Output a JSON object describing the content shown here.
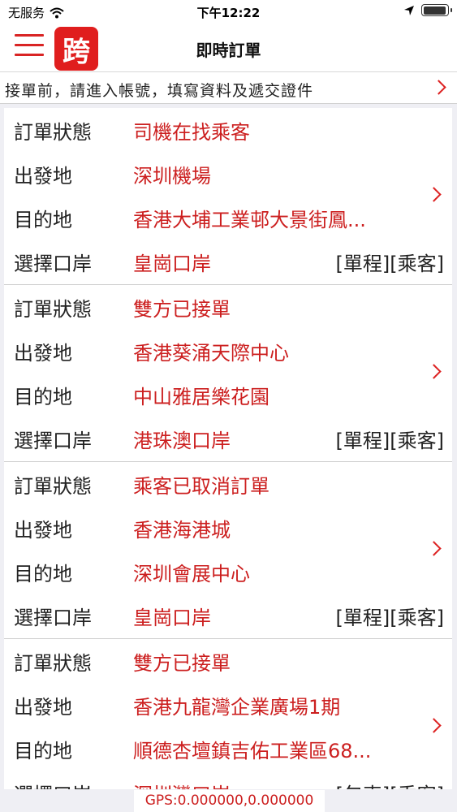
{
  "status_bar": {
    "carrier": "无服务",
    "time": "下午12:22"
  },
  "header": {
    "logo_char": "跨",
    "title": "即時訂單"
  },
  "notice": {
    "text": "接單前，請進入帳號，填寫資料及遞交證件"
  },
  "labels": {
    "status": "訂單狀態",
    "origin": "出發地",
    "destination": "目的地",
    "port": "選擇口岸"
  },
  "orders": [
    {
      "status": "司機在找乘客",
      "origin": "深圳機場",
      "destination": "香港大埔工業邨大景街鳳...",
      "port": "皇崗口岸",
      "tag": "[單程][乘客]"
    },
    {
      "status": "雙方已接單",
      "origin": "香港葵涌天際中心",
      "destination": "中山雅居樂花園",
      "port": "港珠澳口岸",
      "tag": "[單程][乘客]"
    },
    {
      "status": "乘客已取消訂單",
      "origin": "香港海港城",
      "destination": "深圳會展中心",
      "port": "皇崗口岸",
      "tag": "[單程][乘客]"
    },
    {
      "status": "雙方已接單",
      "origin": "香港九龍灣企業廣場1期",
      "destination": "順德杏壇鎮吉佑工業區68...",
      "port": "深圳灣口岸",
      "tag": "[包車][乘客]"
    }
  ],
  "footer": {
    "gps": "GPS:0.000000,0.000000"
  },
  "colors": {
    "accent": "#cc1f1f",
    "logo_bg": "#e01e1e"
  }
}
